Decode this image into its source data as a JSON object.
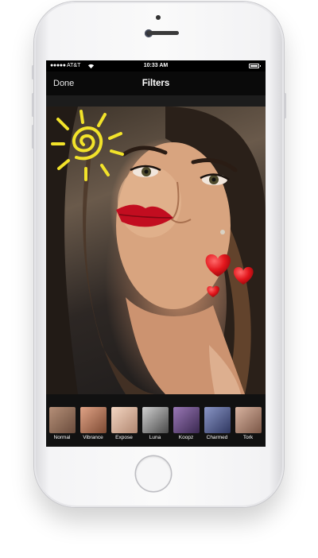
{
  "status_bar": {
    "signal": "●●●●●",
    "carrier": "AT&T",
    "time": "10:33 AM"
  },
  "nav_bar": {
    "done_label": "Done",
    "title": "Filters"
  },
  "stickers": [
    "sun-sticker",
    "hearts-sticker"
  ],
  "filters": [
    {
      "label": "Normal",
      "tint": "#9a7a69"
    },
    {
      "label": "Vibrance",
      "tint": "#b7826a"
    },
    {
      "label": "Expose",
      "tint": "#d8b29b"
    },
    {
      "label": "Luna",
      "tint": "#8d8d8d"
    },
    {
      "label": "Koopz",
      "tint": "#6a4e7e"
    },
    {
      "label": "Charmed",
      "tint": "#5c6690"
    },
    {
      "label": "Tork",
      "tint": "#b08976"
    }
  ],
  "colors": {
    "screen_background": "#000000",
    "nav_background": "#0a0a0a",
    "phone_body": "#f4f4f6",
    "sun_sticker": "#f2e32a",
    "heart_sticker": "#e3161c"
  }
}
